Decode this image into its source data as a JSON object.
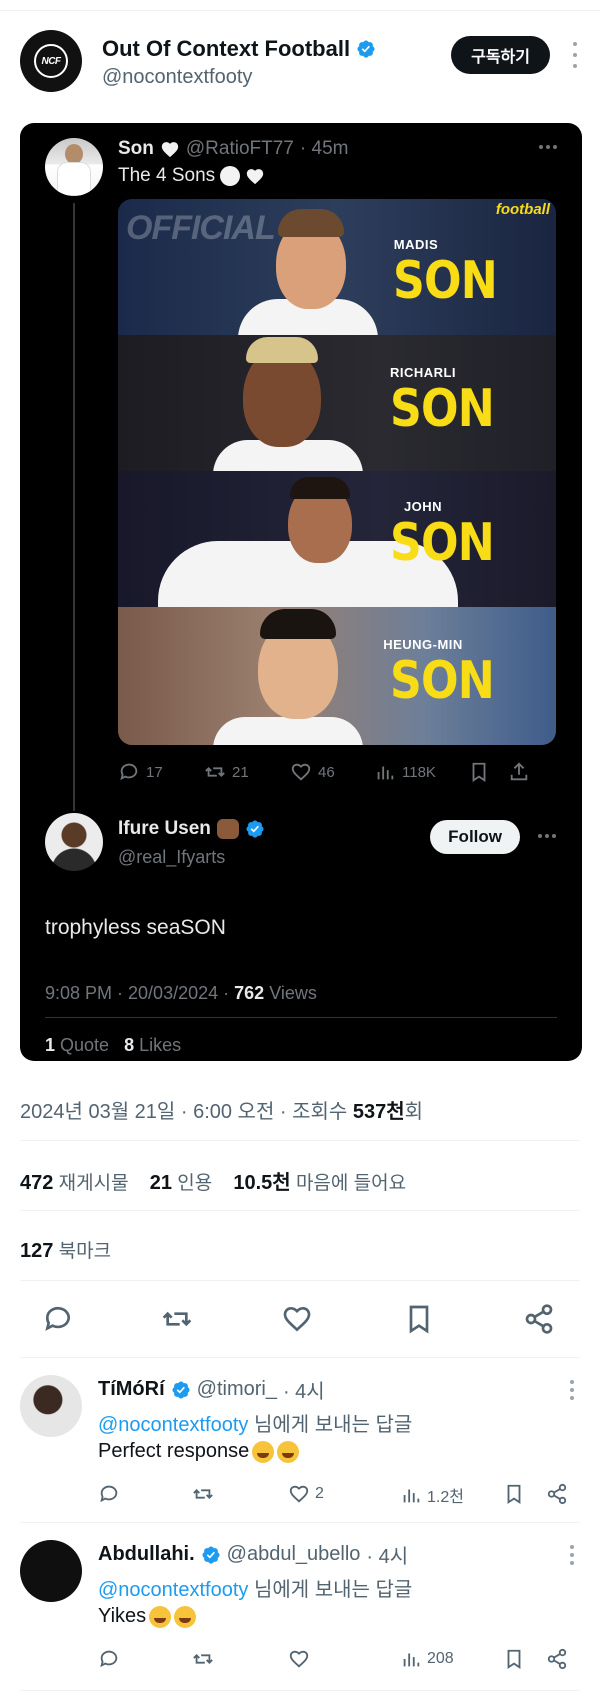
{
  "header": {
    "logo_text": "NCF",
    "name": "Out Of Context Football",
    "handle": "@nocontextfooty",
    "subscribe_label": "구독하기"
  },
  "quoted": {
    "name": "Son",
    "handle": "@RatioFT77",
    "time": "· 45m",
    "text": "The 4 Sons",
    "watermark": "football",
    "bg_text": "OFFICIAL",
    "panels": [
      {
        "first": "MADIS",
        "last": "SON"
      },
      {
        "first": "RICHARLI",
        "last": "SON"
      },
      {
        "first": "JOHN",
        "last": "SON"
      },
      {
        "first": "HEUNG-MIN",
        "last": "SON"
      }
    ],
    "actions": {
      "replies": "17",
      "reposts": "21",
      "likes": "46",
      "views": "118K"
    }
  },
  "reply_tweet": {
    "name": "Ifure Usen",
    "handle": "@real_Ifyarts",
    "follow_label": "Follow",
    "text": "trophyless seaSON",
    "time": "9:08 PM · 20/03/2024 ·",
    "views_count": "762",
    "views_label": "Views",
    "quote_count": "1",
    "quote_label": "Quote",
    "likes_count": "8",
    "likes_label": "Likes"
  },
  "post_meta": {
    "date": "2024년 03월 21일 · 6:00 오전 · 조회수",
    "views": "537천",
    "views_suffix": "회"
  },
  "stats": {
    "reposts": "472",
    "reposts_label": "재게시물",
    "quotes": "21",
    "quotes_label": "인용",
    "likes": "10.5천",
    "likes_label": "마음에 들어요"
  },
  "bookmarks": {
    "count": "127",
    "label": "북마크"
  },
  "replies": [
    {
      "name": "TíMóRí",
      "handle": "@timori_",
      "time": "· 4시",
      "to_handle": "@nocontextfooty",
      "to_suffix": "님에게 보내는 답글",
      "text": "Perfect response",
      "likes": "2",
      "views": "1.2천"
    },
    {
      "name": "Abdullahi.",
      "handle": "@abdul_ubello",
      "time": "· 4시",
      "to_handle": "@nocontextfooty",
      "to_suffix": "님에게 보내는 답글",
      "text": "Yikes",
      "likes": "",
      "views": "208"
    }
  ],
  "colors": {
    "accent": "#1d9bf0",
    "son_yellow": "#f7dc16",
    "dark_bg": "#000000"
  }
}
